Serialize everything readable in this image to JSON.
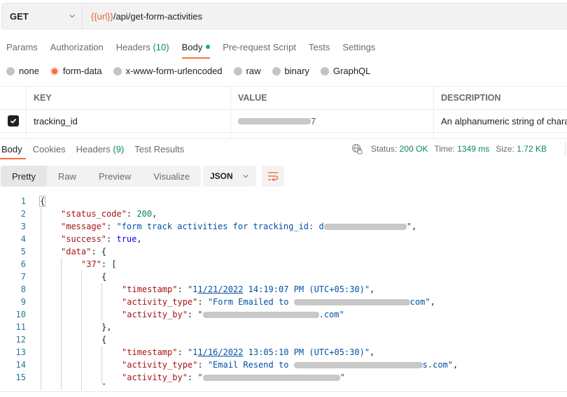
{
  "request": {
    "method": "GET",
    "url_variable": "{{url}}",
    "url_path": "/api/get-form-activities"
  },
  "request_tabs": [
    {
      "label": "Params",
      "count": null,
      "active": false
    },
    {
      "label": "Authorization",
      "count": null,
      "active": false
    },
    {
      "label": "Headers",
      "count": "(10)",
      "active": false
    },
    {
      "label": "Body",
      "count": null,
      "active": true,
      "has_dot": true
    },
    {
      "label": "Pre-request Script",
      "count": null,
      "active": false
    },
    {
      "label": "Tests",
      "count": null,
      "active": false
    },
    {
      "label": "Settings",
      "count": null,
      "active": false
    }
  ],
  "body_types": [
    {
      "label": "none",
      "checked": false
    },
    {
      "label": "form-data",
      "checked": true
    },
    {
      "label": "x-www-form-urlencoded",
      "checked": false
    },
    {
      "label": "raw",
      "checked": false
    },
    {
      "label": "binary",
      "checked": false
    },
    {
      "label": "GraphQL",
      "checked": false
    }
  ],
  "params_table": {
    "headers": [
      "KEY",
      "VALUE",
      "DESCRIPTION"
    ],
    "rows": [
      {
        "checked": true,
        "key": "tracking_id",
        "value_visible_tail": "7",
        "value_redacted": true,
        "description": "An alphanumeric string of charac"
      }
    ]
  },
  "response_tabs": [
    {
      "label": "Body",
      "count": null,
      "active": true
    },
    {
      "label": "Cookies",
      "count": null,
      "active": false
    },
    {
      "label": "Headers",
      "count": "(9)",
      "active": false
    },
    {
      "label": "Test Results",
      "count": null,
      "active": false
    }
  ],
  "response_status": {
    "status_label": "Status:",
    "status_value": "200 OK",
    "time_label": "Time:",
    "time_value": "1349 ms",
    "size_label": "Size:",
    "size_value": "1.72 KB"
  },
  "view_modes": [
    {
      "label": "Pretty",
      "active": true
    },
    {
      "label": "Raw",
      "active": false
    },
    {
      "label": "Preview",
      "active": false
    },
    {
      "label": "Visualize",
      "active": false
    }
  ],
  "format": "JSON",
  "code": {
    "line_numbers": [
      "1",
      "2",
      "3",
      "4",
      "5",
      "6",
      "7",
      "8",
      "9",
      "10",
      "11",
      "12",
      "13",
      "14",
      "15"
    ],
    "status_code_key": "\"status_code\"",
    "status_code_value": "200",
    "message_key": "\"message\"",
    "message_value_prefix": "\"form track activities for tracking_id: d",
    "success_key": "\"success\"",
    "success_value": "true",
    "data_key": "\"data\"",
    "group_key": "\"37\"",
    "items": [
      {
        "timestamp_key": "\"timestamp\"",
        "timestamp_q": "\"1",
        "timestamp_link": "1/21/2022",
        "timestamp_rest": " 14:19:07 PM (UTC+05:30)\"",
        "activity_type_key": "\"activity_type\"",
        "activity_type_prefix": "\"Form Emailed to ",
        "activity_type_suffix": "com\"",
        "activity_by_key": "\"activity_by\"",
        "activity_by_prefix": "\"",
        "activity_by_suffix": ".com\""
      },
      {
        "timestamp_key": "\"timestamp\"",
        "timestamp_q": "\"1",
        "timestamp_link": "1/16/2022",
        "timestamp_rest": " 13:05:10 PM (UTC+05:30)\"",
        "activity_type_key": "\"activity_type\"",
        "activity_type_prefix": "\"Email Resend to ",
        "activity_type_suffix": "s.com\"",
        "activity_by_key": "\"activity_by\"",
        "activity_by_prefix": "\"",
        "activity_by_suffix": "\""
      }
    ]
  },
  "colors": {
    "accent": "#ff6c37",
    "success_green": "#0b8a5a",
    "body_dot": "#0cbb52",
    "json_key": "#a31515",
    "json_string": "#0451a5",
    "json_number": "#098658",
    "json_boolean": "#0000ff",
    "line_number": "#237893"
  }
}
